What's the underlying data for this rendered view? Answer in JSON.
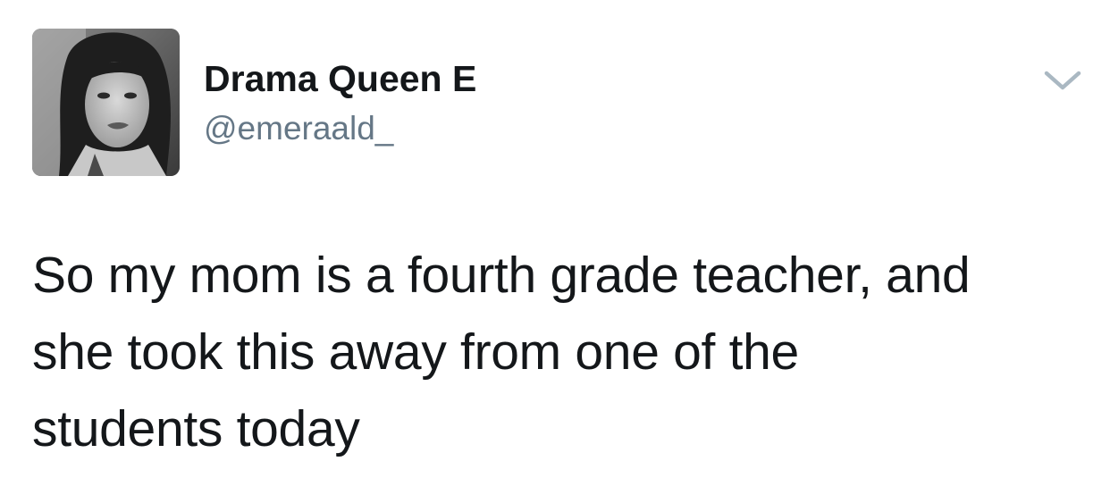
{
  "tweet": {
    "author": {
      "display_name": "Drama Queen E",
      "handle": "@emeraald_",
      "avatar_icon": "profile-photo"
    },
    "menu_icon": "chevron-down-icon",
    "text_lines": [
      "So my mom is a fourth grade teacher, and",
      "she took this away from one of the",
      "students today"
    ]
  },
  "colors": {
    "text_primary": "#14171a",
    "text_secondary": "#657786",
    "caret": "#aab8c2",
    "background": "#ffffff"
  }
}
